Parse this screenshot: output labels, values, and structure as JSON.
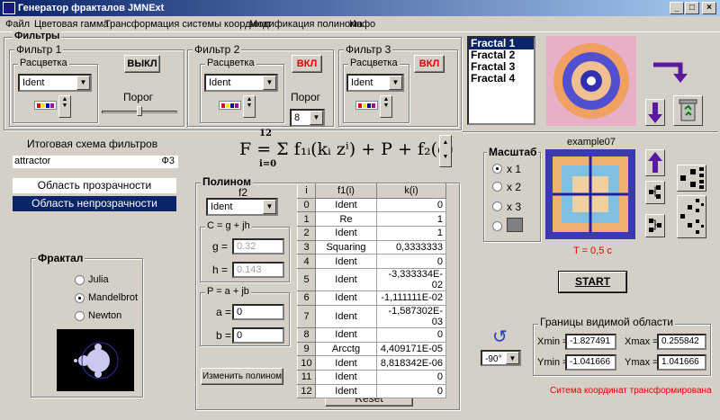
{
  "window": {
    "title": "Генератор фракталов JMNExt",
    "min": "_",
    "max": "□",
    "close": "×"
  },
  "menu": [
    "Файл",
    "Цветовая гамма",
    "Трансформация системы координат",
    "Модификация полинома",
    "Инфо"
  ],
  "filters": {
    "title": "Фильтры",
    "f1": {
      "title": "Фильтр 1",
      "coloring": "Расцветка",
      "combo": "Ident",
      "toggle": "ВЫКЛ",
      "threshold_label": "Порог"
    },
    "f2": {
      "title": "Фильтр 2",
      "coloring": "Расцветка",
      "combo": "Ident",
      "toggle": "ВКЛ",
      "threshold_label": "Порог",
      "threshold": "8"
    },
    "f3": {
      "title": "Фильтр 3",
      "coloring": "Расцветка",
      "combo": "Ident",
      "toggle": "ВКЛ"
    }
  },
  "scheme": {
    "label": "Итоговая схема фильтров",
    "value": "attractor",
    "suffix": "Ф3",
    "transparent": "Область прозрачности",
    "opaque": "Область непрозрачности"
  },
  "formula": {
    "text": "F = Σ f₁ᵢ(kᵢ zⁱ) + P + f₂(c)",
    "upper": "12",
    "lower": "i=0"
  },
  "fractal": {
    "title": "Фрактал",
    "options": [
      "Julia",
      "Mandelbrot",
      "Newton"
    ],
    "selected": "Mandelbrot"
  },
  "polynom": {
    "title": "Полином",
    "f2_label": "f2",
    "f2_combo": "Ident",
    "c_title": "C = g + jh",
    "g_label": "g =",
    "g": "0.32",
    "h_label": "h =",
    "h": "0.143",
    "p_title": "P = a + jb",
    "a_label": "a =",
    "a": "0",
    "b_label": "b =",
    "b": "0",
    "change_btn": "Изменить полином",
    "reset_btn": "Reset"
  },
  "table": {
    "headers": [
      "i",
      "f1(i)",
      "k(i)"
    ],
    "rows": [
      [
        "0",
        "Ident",
        "0"
      ],
      [
        "1",
        "Re",
        "1"
      ],
      [
        "2",
        "Ident",
        "1"
      ],
      [
        "3",
        "Squaring",
        "0,3333333"
      ],
      [
        "4",
        "Ident",
        "0"
      ],
      [
        "5",
        "Ident",
        "-3,333334E-02"
      ],
      [
        "6",
        "Ident",
        "-1,111111E-02"
      ],
      [
        "7",
        "Ident",
        "-1,587302E-03"
      ],
      [
        "8",
        "Ident",
        "0"
      ],
      [
        "9",
        "Arcctg",
        "4,409171E-05"
      ],
      [
        "10",
        "Ident",
        "8,818342E-06"
      ],
      [
        "11",
        "Ident",
        "0"
      ],
      [
        "12",
        "Ident",
        "0"
      ]
    ]
  },
  "presets": {
    "items": [
      "Fractal 1",
      "Fractal 2",
      "Fractal 3",
      "Fractal 4"
    ],
    "selected": "Fractal 1"
  },
  "scale": {
    "title": "Масштаб",
    "options": [
      "x 1",
      "x 2",
      "x 3"
    ],
    "selected": "x 1"
  },
  "preview": {
    "name": "example07",
    "time": "T = 0,5 c"
  },
  "start_btn": "START",
  "rotation": {
    "value": "-90°"
  },
  "bounds": {
    "title": "Границы видимой области",
    "xmin_label": "Xmin =",
    "xmin": "-1.827491",
    "xmax_label": "Xmax =",
    "xmax": "0.255842",
    "ymin_label": "Ymin =",
    "ymin": "-1.041666",
    "ymax_label": "Ymax =",
    "ymax": "1.041666"
  },
  "status": "Ситема координат трансформирована",
  "colors": {
    "title_bar": "#0a246a",
    "selection": "#0a246a",
    "status_red": "#e00000",
    "accent_purple": "#5a1aa0"
  }
}
